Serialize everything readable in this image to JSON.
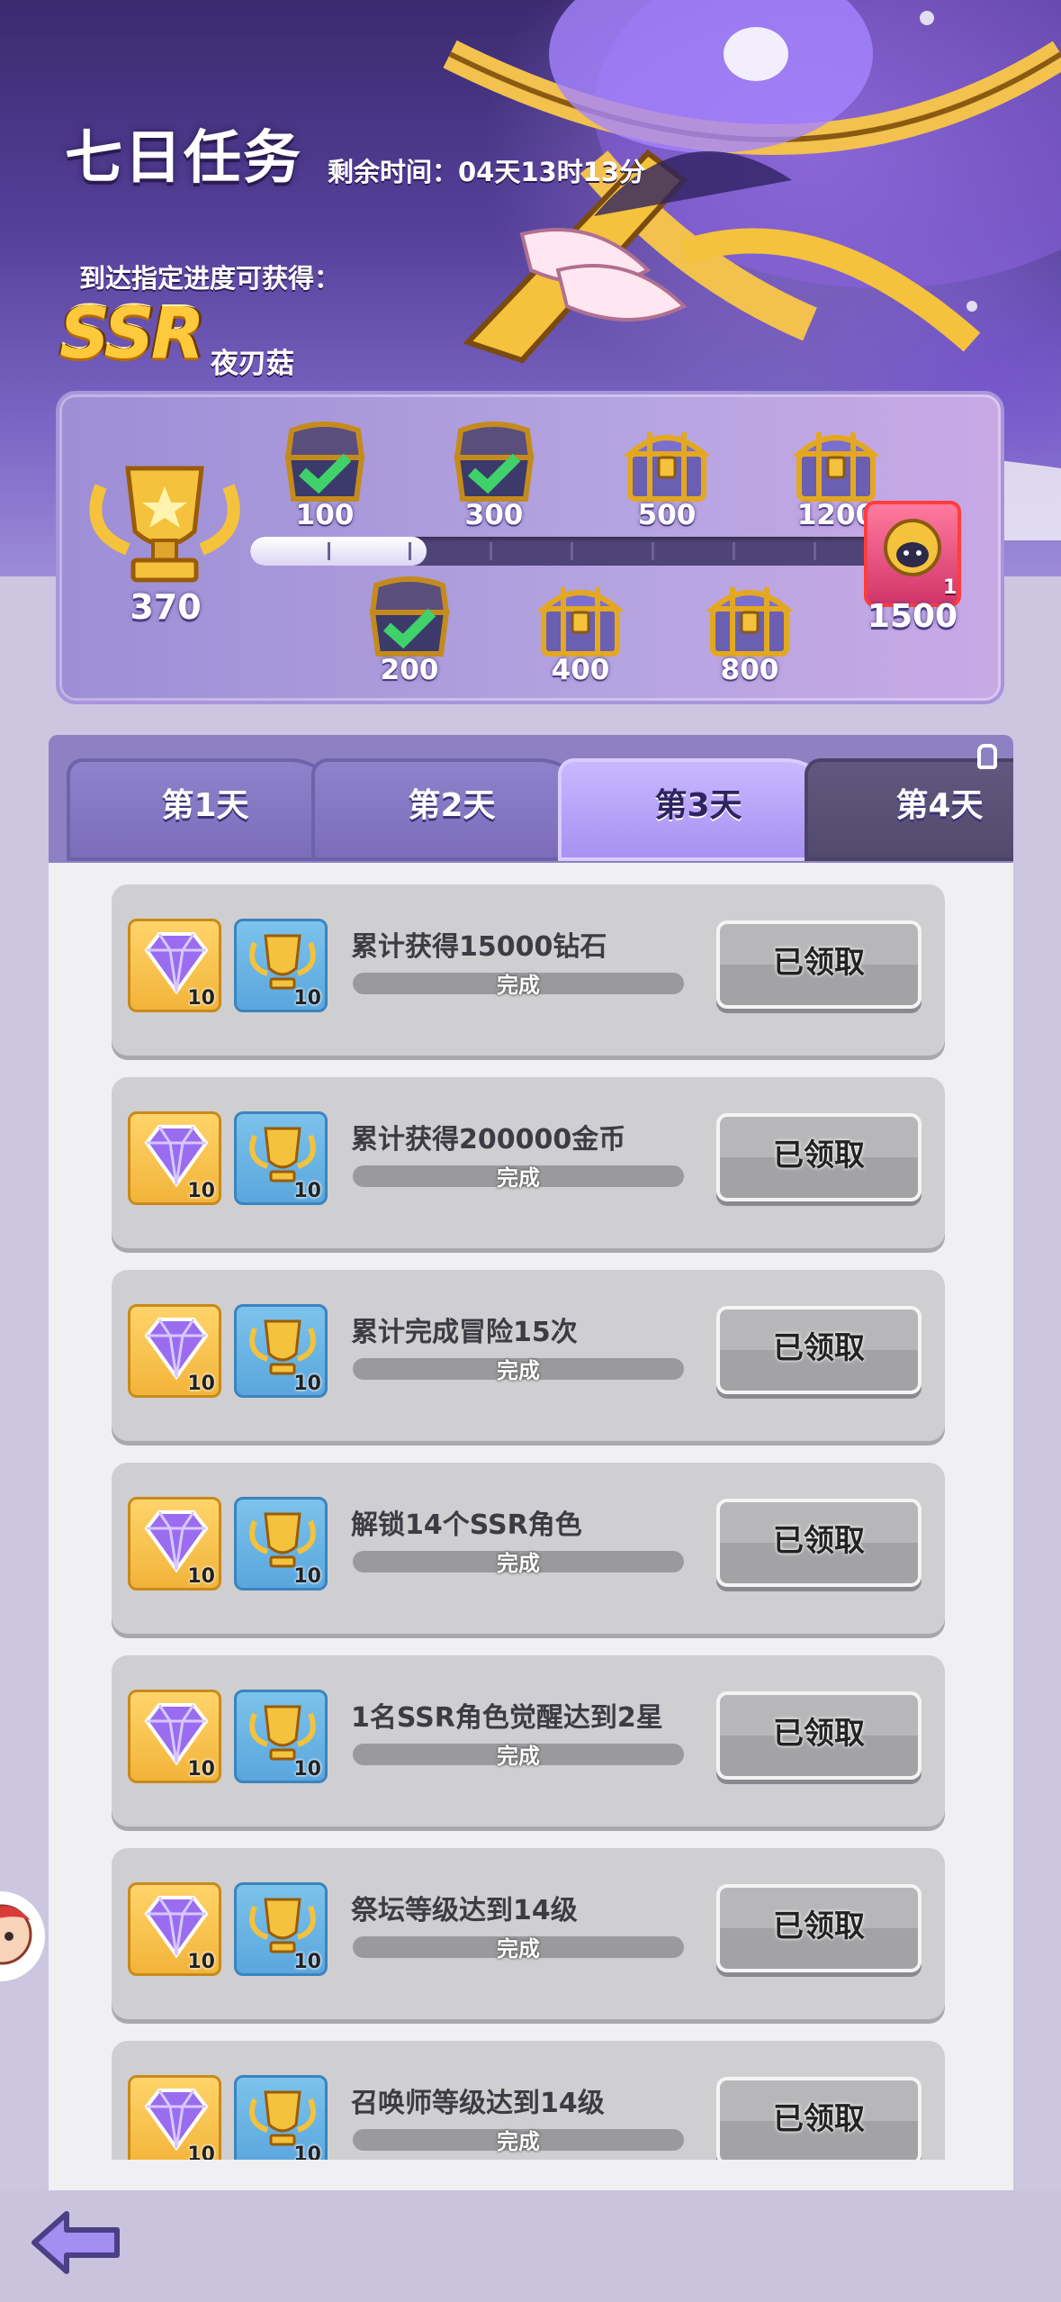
{
  "header": {
    "title": "七日任务",
    "time_remaining": "剩余时间：04天13时13分",
    "reward_hint": "到达指定进度可获得：",
    "reward_rarity": "SSR",
    "reward_name": "夜刃菇"
  },
  "progress": {
    "current_points": "370",
    "max_points": 1500,
    "fill_fraction": 0.28,
    "milestones_top": [
      {
        "label": "100",
        "claimed": true
      },
      {
        "label": "300",
        "claimed": true
      },
      {
        "label": "500",
        "claimed": false
      },
      {
        "label": "1200",
        "claimed": false
      }
    ],
    "milestones_bottom": [
      {
        "label": "200",
        "claimed": true
      },
      {
        "label": "400",
        "claimed": false
      },
      {
        "label": "800",
        "claimed": false
      }
    ],
    "final": {
      "label": "1500",
      "qty": "1"
    }
  },
  "tabs": [
    {
      "label": "第1天",
      "state": "normal"
    },
    {
      "label": "第2天",
      "state": "normal"
    },
    {
      "label": "第3天",
      "state": "active"
    },
    {
      "label": "第4天",
      "state": "locked"
    }
  ],
  "tasks": [
    {
      "title": "累计获得15000钻石",
      "status": "完成",
      "button": "已领取",
      "rewards": [
        "10",
        "10"
      ]
    },
    {
      "title": "累计获得200000金币",
      "status": "完成",
      "button": "已领取",
      "rewards": [
        "10",
        "10"
      ]
    },
    {
      "title": "累计完成冒险15次",
      "status": "完成",
      "button": "已领取",
      "rewards": [
        "10",
        "10"
      ]
    },
    {
      "title": "解锁14个SSR角色",
      "status": "完成",
      "button": "已领取",
      "rewards": [
        "10",
        "10"
      ]
    },
    {
      "title": "1名SSR角色觉醒达到2星",
      "status": "完成",
      "button": "已领取",
      "rewards": [
        "10",
        "10"
      ]
    },
    {
      "title": "祭坛等级达到14级",
      "status": "完成",
      "button": "已领取",
      "rewards": [
        "10",
        "10"
      ]
    },
    {
      "title": "召唤师等级达到14级",
      "status": "完成",
      "button": "已领取",
      "rewards": [
        "10",
        "10"
      ]
    }
  ],
  "icons": {
    "back": "back-arrow-icon",
    "diamond": "purple-diamond-icon",
    "trophy": "gold-trophy-icon",
    "chest": "treasure-chest-icon",
    "check": "green-check-icon"
  },
  "colors": {
    "accent": "#8d81c4",
    "active_tab": "#b9a5f8",
    "check": "#3fd16a",
    "gold": "#f4c23c"
  }
}
